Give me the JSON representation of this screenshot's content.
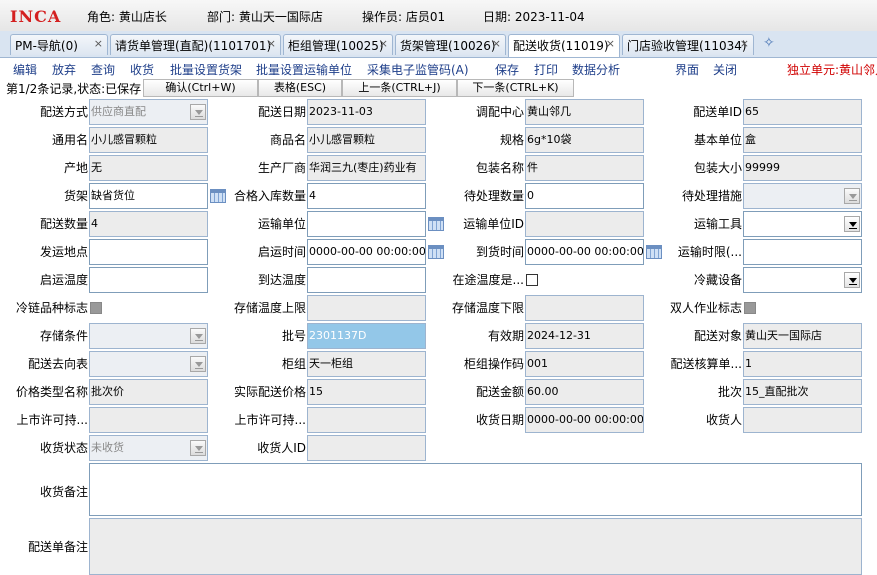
{
  "header": {
    "logo": "INCA",
    "role": "角色: 黄山店长",
    "dept": "部门: 黄山天一国际店",
    "operator": "操作员: 店员01",
    "date": "日期: 2023-11-04"
  },
  "tabs": [
    {
      "label": "PM-导航(0)",
      "close": "×"
    },
    {
      "label": "请货单管理(直配)(1101701)",
      "close": "×"
    },
    {
      "label": "柜组管理(10025)",
      "close": "×"
    },
    {
      "label": "货架管理(10026)",
      "close": "×"
    },
    {
      "label": "配送收货(11019)",
      "close": "×"
    },
    {
      "label": "门店验收管理(11034)",
      "close": "×"
    }
  ],
  "tab_add": "✧",
  "menu": {
    "edit": "编辑",
    "discard": "放弃",
    "query": "查询",
    "receive": "收货",
    "batch_shelf": "批量设置货架",
    "batch_transport": "批量设置运输单位",
    "collect_code": "采集电子监管码(A)",
    "save": "保存",
    "print": "打印",
    "analysis": "数据分析",
    "interface": "界面",
    "close": "关闭",
    "unit": "独立单元:黄山邻几"
  },
  "status": {
    "record": "第1/2条记录,状态:已保存",
    "confirm": "确认(Ctrl+W)",
    "table": "表格(ESC)",
    "prev": "上一条(CTRL+J)",
    "next": "下一条(CTRL+K)"
  },
  "form": {
    "delivery_mode": {
      "label": "配送方式",
      "value": "供应商直配"
    },
    "delivery_date": {
      "label": "配送日期",
      "value": "2023-11-03"
    },
    "dispatch_center": {
      "label": "调配中心",
      "value": "黄山邻几"
    },
    "delivery_id": {
      "label": "配送单ID",
      "value": "65"
    },
    "common_name": {
      "label": "通用名",
      "value": "小儿感冒颗粒"
    },
    "product_name": {
      "label": "商品名",
      "value": "小儿感冒颗粒"
    },
    "spec": {
      "label": "规格",
      "value": "6g*10袋"
    },
    "base_unit": {
      "label": "基本单位",
      "value": "盒"
    },
    "origin": {
      "label": "产地",
      "value": "无"
    },
    "manufacturer": {
      "label": "生产厂商",
      "value": "华润三九(枣庄)药业有"
    },
    "pack_name": {
      "label": "包装名称",
      "value": "件"
    },
    "pack_size": {
      "label": "包装大小",
      "value": "99999"
    },
    "shelf": {
      "label": "货架",
      "value": "缺省货位"
    },
    "qualified_qty": {
      "label": "合格入库数量",
      "value": "4"
    },
    "pending_qty": {
      "label": "待处理数量",
      "value": "0"
    },
    "pending_action": {
      "label": "待处理措施",
      "value": ""
    },
    "delivery_qty": {
      "label": "配送数量",
      "value": "4"
    },
    "transport_unit": {
      "label": "运输单位",
      "value": ""
    },
    "transport_unit_id": {
      "label": "运输单位ID",
      "value": ""
    },
    "transport_tool": {
      "label": "运输工具",
      "value": ""
    },
    "ship_from": {
      "label": "发运地点",
      "value": ""
    },
    "start_time": {
      "label": "启运时间",
      "value": "0000-00-00 00:00:00"
    },
    "arrive_time": {
      "label": "到货时间",
      "value": "0000-00-00 00:00:00"
    },
    "transport_limit": {
      "label": "运输时限(...",
      "value": ""
    },
    "start_temp": {
      "label": "启运温度",
      "value": ""
    },
    "arrive_temp": {
      "label": "到达温度",
      "value": ""
    },
    "in_transit_temp": {
      "label": "在途温度是...",
      "value": ""
    },
    "cold_device": {
      "label": "冷藏设备",
      "value": ""
    },
    "cold_chain": {
      "label": "冷链品种标志",
      "value": ""
    },
    "storage_temp_max": {
      "label": "存储温度上限",
      "value": ""
    },
    "storage_temp_min": {
      "label": "存储温度下限",
      "value": ""
    },
    "double_op": {
      "label": "双人作业标志",
      "value": ""
    },
    "storage_cond": {
      "label": "存储条件",
      "value": ""
    },
    "batch_no": {
      "label": "批号",
      "value": "2301137D"
    },
    "expiry": {
      "label": "有效期",
      "value": "2024-12-31"
    },
    "delivery_target": {
      "label": "配送对象",
      "value": "黄山天一国际店"
    },
    "delivery_direction": {
      "label": "配送去向表",
      "value": ""
    },
    "counter_group": {
      "label": "柜组",
      "value": "天一柜组"
    },
    "counter_op_code": {
      "label": "柜组操作码",
      "value": "001"
    },
    "delivery_calc": {
      "label": "配送核算单...",
      "value": "1"
    },
    "price_type": {
      "label": "价格类型名称",
      "value": "批次价"
    },
    "actual_price": {
      "label": "实际配送价格",
      "value": "15"
    },
    "delivery_amount": {
      "label": "配送金额",
      "value": "60.00"
    },
    "batch": {
      "label": "批次",
      "value": "15_直配批次"
    },
    "license1": {
      "label": "上市许可持...",
      "value": ""
    },
    "license2": {
      "label": "上市许可持...",
      "value": ""
    },
    "receive_date": {
      "label": "收货日期",
      "value": "0000-00-00 00:00:00"
    },
    "receiver": {
      "label": "收货人",
      "value": ""
    },
    "receive_status": {
      "label": "收货状态",
      "value": "未收货"
    },
    "receiver_id": {
      "label": "收货人ID",
      "value": ""
    },
    "receive_note": {
      "label": "收货备注",
      "value": ""
    },
    "delivery_note": {
      "label": "配送单备注",
      "value": ""
    }
  }
}
